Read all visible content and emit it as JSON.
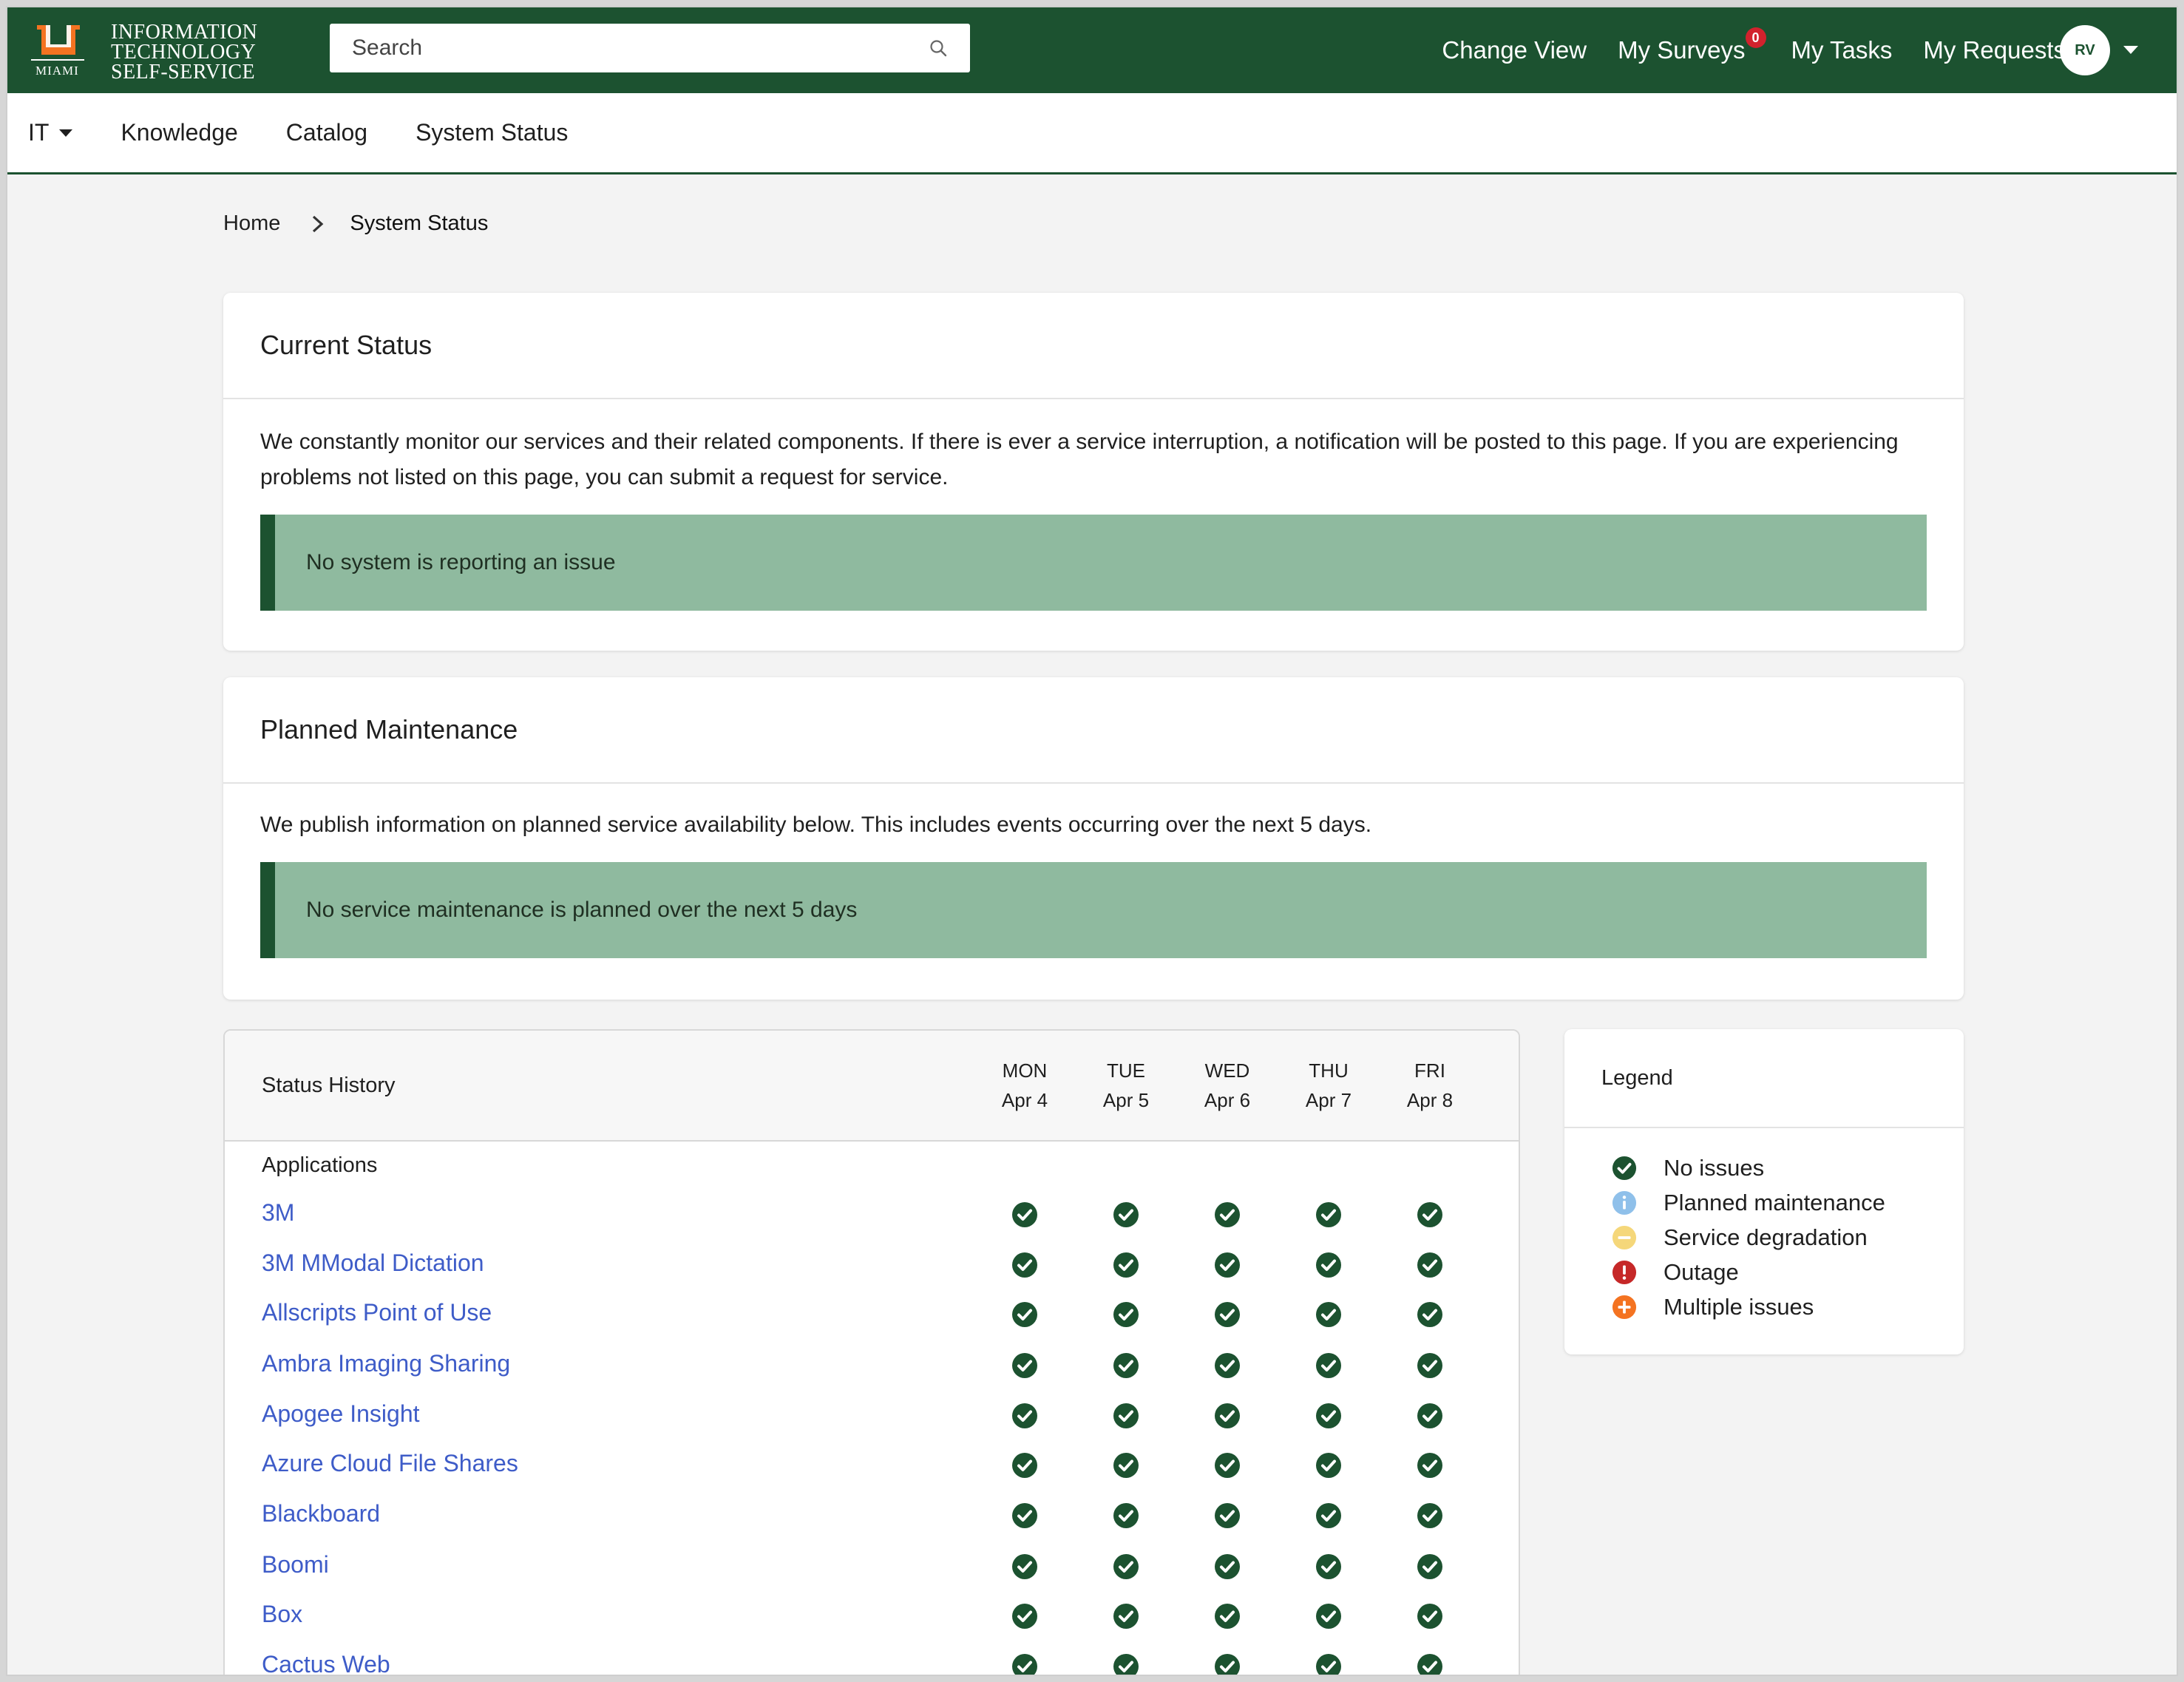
{
  "header": {
    "logo": {
      "line1": "INFORMATION",
      "line2": "TECHNOLOGY",
      "line3": "SELF-SERVICE",
      "wordmark": "MIAMI"
    },
    "search": {
      "placeholder": "Search"
    },
    "nav": {
      "change_view": "Change View",
      "my_surveys": "My Surveys",
      "surveys_badge": "0",
      "my_tasks": "My Tasks",
      "my_requests": "My Requests"
    },
    "avatar_initials": "RV",
    "colors": {
      "brand_green": "#1c5230",
      "brand_orange": "#f47321"
    }
  },
  "subnav": {
    "it": "IT",
    "knowledge": "Knowledge",
    "catalog": "Catalog",
    "system_status": "System Status"
  },
  "breadcrumb": {
    "home": "Home",
    "current": "System Status"
  },
  "current_status": {
    "title": "Current Status",
    "text": "We constantly monitor our services and their related components. If there is ever a service interruption, a notification will be posted to this page. If you are experiencing problems not listed on this page, you can submit a request for service.",
    "alert": "No system is reporting an issue"
  },
  "planned_maintenance": {
    "title": "Planned Maintenance",
    "text": "We publish information on planned service availability below. This includes events occurring over the next 5 days.",
    "alert": "No service maintenance is planned over the next 5 days"
  },
  "status_history": {
    "title": "Status History",
    "days": [
      {
        "dow": "MON",
        "date": "Apr 4"
      },
      {
        "dow": "TUE",
        "date": "Apr 5"
      },
      {
        "dow": "WED",
        "date": "Apr 6"
      },
      {
        "dow": "THU",
        "date": "Apr 7"
      },
      {
        "dow": "FRI",
        "date": "Apr 8"
      }
    ],
    "section": "Applications",
    "rows": [
      {
        "name": "3M",
        "status": [
          "ok",
          "ok",
          "ok",
          "ok",
          "ok"
        ]
      },
      {
        "name": "3M MModal Dictation",
        "status": [
          "ok",
          "ok",
          "ok",
          "ok",
          "ok"
        ]
      },
      {
        "name": "Allscripts Point of Use",
        "status": [
          "ok",
          "ok",
          "ok",
          "ok",
          "ok"
        ]
      },
      {
        "name": "Ambra Imaging Sharing",
        "status": [
          "ok",
          "ok",
          "ok",
          "ok",
          "ok"
        ]
      },
      {
        "name": "Apogee Insight",
        "status": [
          "ok",
          "ok",
          "ok",
          "ok",
          "ok"
        ]
      },
      {
        "name": "Azure Cloud File Shares",
        "status": [
          "ok",
          "ok",
          "ok",
          "ok",
          "ok"
        ]
      },
      {
        "name": "Blackboard",
        "status": [
          "ok",
          "ok",
          "ok",
          "ok",
          "ok"
        ]
      },
      {
        "name": "Boomi",
        "status": [
          "ok",
          "ok",
          "ok",
          "ok",
          "ok"
        ]
      },
      {
        "name": "Box",
        "status": [
          "ok",
          "ok",
          "ok",
          "ok",
          "ok"
        ]
      },
      {
        "name": "Cactus Web",
        "status": [
          "ok",
          "ok",
          "ok",
          "ok",
          "ok"
        ]
      }
    ]
  },
  "legend": {
    "title": "Legend",
    "items": [
      {
        "label": "No issues",
        "icon": "check-circle-icon",
        "color": "#1c5230"
      },
      {
        "label": "Planned maintenance",
        "icon": "info-circle-icon",
        "color": "#8fc0ea"
      },
      {
        "label": "Service degradation",
        "icon": "minus-circle-icon",
        "color": "#f5d77a"
      },
      {
        "label": "Outage",
        "icon": "exclamation-circle-icon",
        "color": "#c62828"
      },
      {
        "label": "Multiple issues",
        "icon": "plus-circle-icon",
        "color": "#f47321"
      }
    ]
  }
}
